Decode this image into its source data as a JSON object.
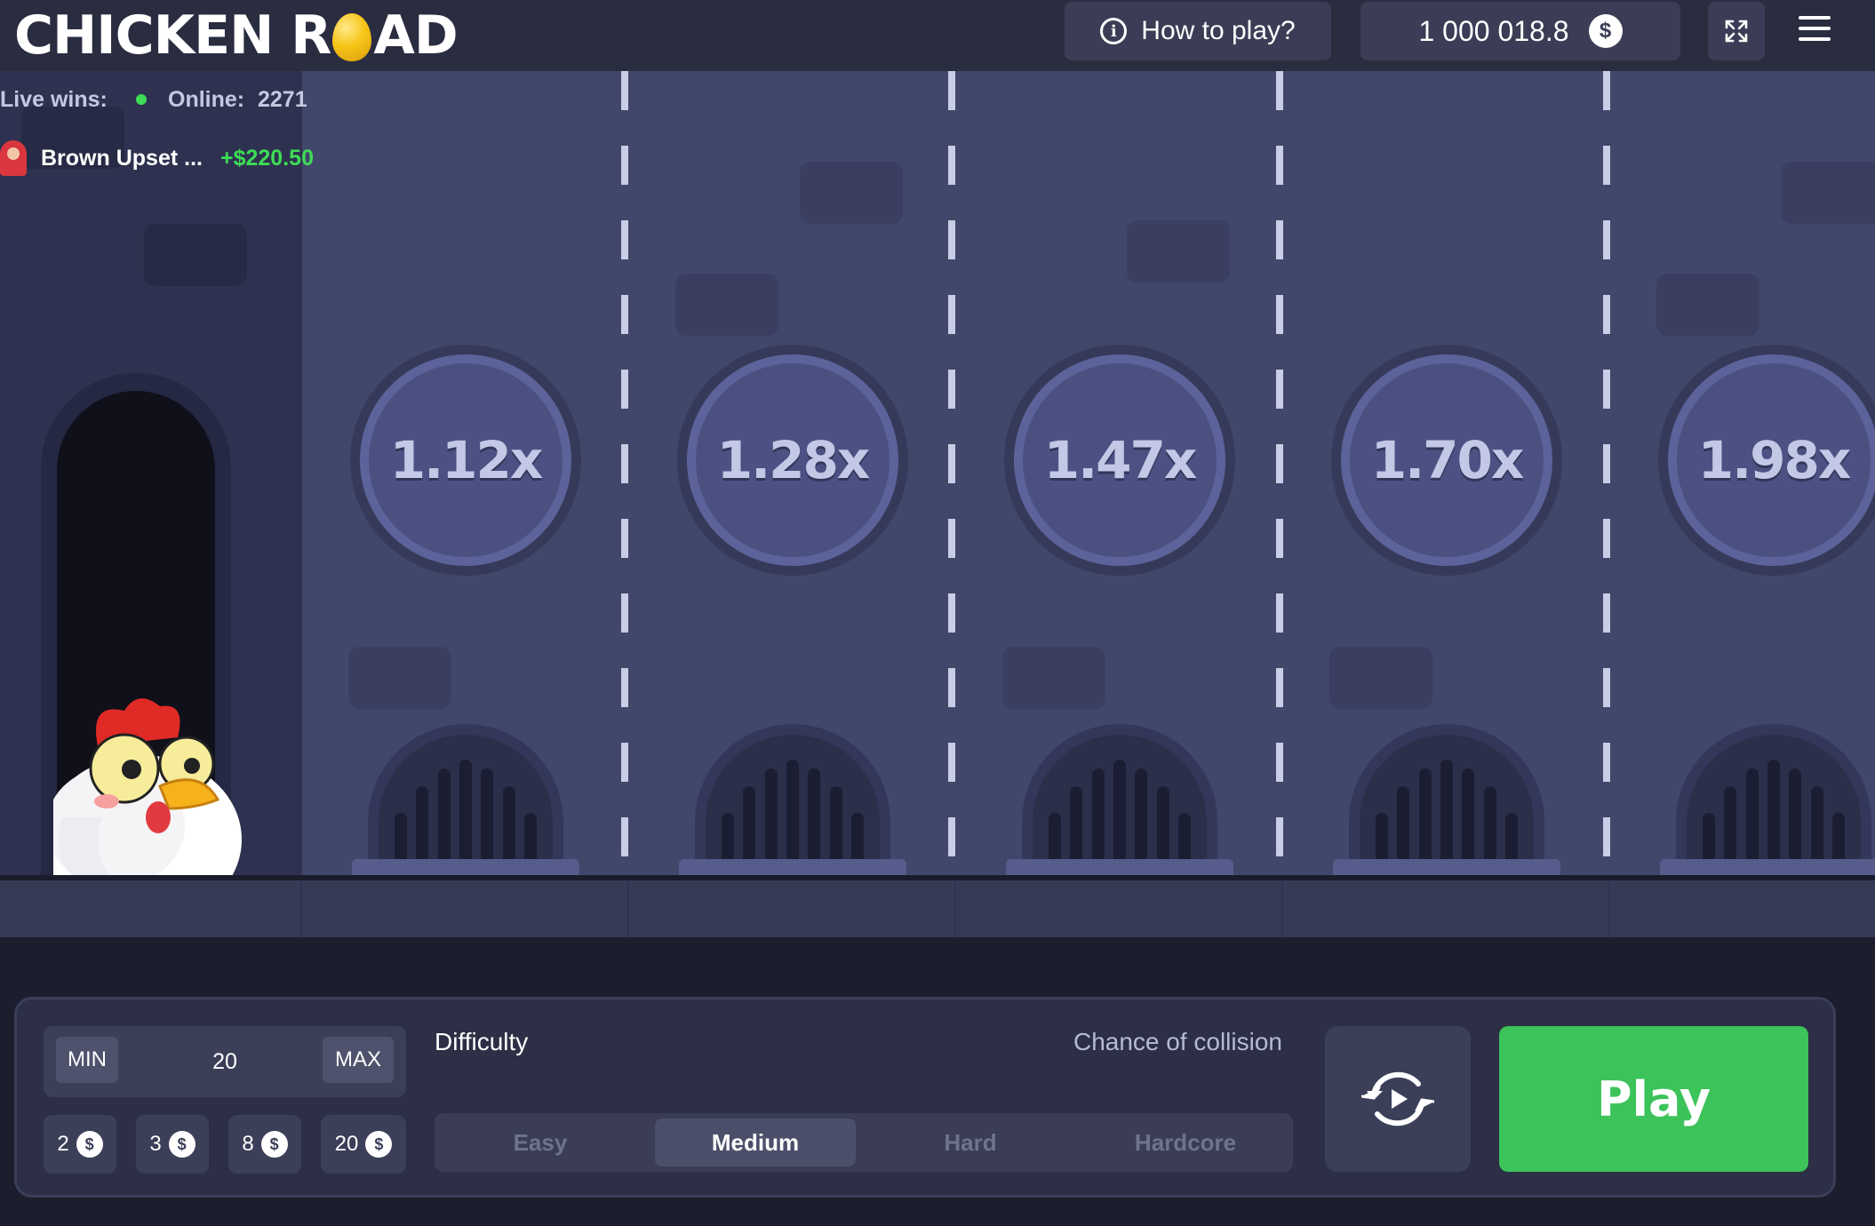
{
  "header": {
    "logo_left": "CHICKEN R",
    "logo_right": "AD",
    "how_to_play": "How to play?",
    "info_glyph": "i",
    "balance": "1 000 018.8",
    "currency_symbol": "$"
  },
  "live": {
    "live_wins_label": "Live wins:",
    "online_label": "Online:",
    "online_count": "2271",
    "last_win": {
      "player": "Brown Upset ...",
      "amount": "+$220.50"
    }
  },
  "multipliers": [
    "1.12x",
    "1.28x",
    "1.47x",
    "1.70x",
    "1.98x"
  ],
  "controls": {
    "bet": {
      "min_label": "MIN",
      "value": "20",
      "max_label": "MAX"
    },
    "quick_bets": [
      "2",
      "3",
      "8",
      "20"
    ],
    "difficulty_label": "Difficulty",
    "chance_label": "Chance of collision",
    "difficulties": [
      "Easy",
      "Medium",
      "Hard",
      "Hardcore"
    ],
    "selected_difficulty": "Medium",
    "play_label": "Play"
  },
  "colors": {
    "accent_green": "#3cc35a",
    "win_green": "#3ddc55",
    "lane_bg": "#41476b",
    "panel_bg": "#2c2f45"
  },
  "icons": {
    "info": "info-icon",
    "coin": "dollar-coin-icon",
    "fullscreen": "fullscreen-icon",
    "menu": "hamburger-menu-icon",
    "repeat": "auto-repeat-icon"
  }
}
